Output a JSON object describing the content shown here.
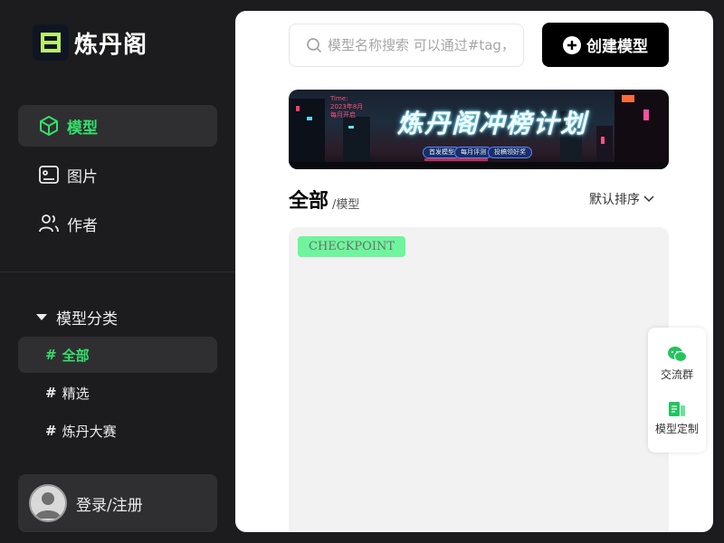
{
  "brand": {
    "name": "炼丹阁"
  },
  "nav": {
    "items": [
      {
        "label": "模型",
        "icon": "cube-icon",
        "active": true
      },
      {
        "label": "图片",
        "icon": "image-icon",
        "active": false
      },
      {
        "label": "作者",
        "icon": "users-icon",
        "active": false
      }
    ]
  },
  "categories": {
    "heading": "模型分类",
    "items": [
      {
        "label": "全部",
        "active": true
      },
      {
        "label": "精选",
        "active": false
      },
      {
        "label": "炼丹大赛",
        "active": false
      }
    ]
  },
  "account": {
    "login_label": "登录/注册"
  },
  "search": {
    "placeholder": "模型名称搜索 可以通过#tag，"
  },
  "toolbar": {
    "create_label": "创建模型"
  },
  "banner": {
    "title": "炼丹阁冲榜计划",
    "side_text": [
      "Time:",
      "2023年8月",
      "每月开启"
    ],
    "pills": [
      "首发模型",
      "每月评测",
      "投稿领好奖"
    ]
  },
  "section": {
    "title": "全部",
    "subtitle": "/模型",
    "sort_label": "默认排序"
  },
  "card": {
    "tag": "CHECKPOINT"
  },
  "floating": {
    "items": [
      {
        "label": "交流群",
        "icon": "wechat-icon"
      },
      {
        "label": "模型定制",
        "icon": "document-icon"
      }
    ]
  },
  "colors": {
    "accent": "#33e06b",
    "sidebar_bg": "#1c1c1e",
    "tag_bg": "#6ef59d"
  }
}
